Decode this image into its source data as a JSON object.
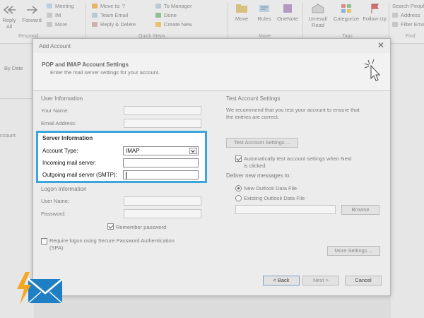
{
  "ribbon": {
    "reply_label": "Reply",
    "reply_all_label": "All",
    "forward_label": "Forward",
    "meeting_label": "Meeting",
    "im_label": "IM",
    "more_label": "More",
    "respond_group": "Respond",
    "move_to_label": "Move to: ?",
    "team_email_label": "Team Email",
    "reply_delete_label": "Reply & Delete",
    "to_manager_label": "To Manager",
    "done_label": "Done",
    "create_new_label": "Create New",
    "quick_steps_group": "Quick Steps",
    "move_label": "Move",
    "rules_label": "Rules",
    "onenote_label": "OneNote",
    "move_group": "Move",
    "unread_read_label": "Unread/ Read",
    "categorize_label": "Categorize",
    "follow_up_label": "Follow Up",
    "tags_group": "Tags",
    "search_people_label": "Search People",
    "address_book_label": "Address",
    "filter_email_label": "Filter Email",
    "find_group": "Find"
  },
  "left_pane": {
    "by_date_label": "By Date",
    "account_label": "ccount"
  },
  "dialog": {
    "title": "Add Account",
    "header_title": "POP and IMAP Account Settings",
    "header_subtitle": "Enter the mail server settings for your account.",
    "user_info": {
      "heading": "User Information",
      "your_name_label": "Your Name:",
      "your_name_value": "",
      "email_label": "Email Address:",
      "email_value": ""
    },
    "server_info": {
      "heading": "Server Information",
      "account_type_label": "Account Type:",
      "account_type_value": "IMAP",
      "incoming_label": "Incoming mail server:",
      "incoming_value": "",
      "outgoing_label": "Outgoing mail server (SMTP):",
      "outgoing_value": ""
    },
    "logon_info": {
      "heading": "Logon Information",
      "user_name_label": "User Name:",
      "user_name_value": "",
      "password_label": "Password:",
      "password_value": "",
      "remember_password_label": "Remember password",
      "remember_password_checked": true,
      "spa_label_line1": "Require logon using Secure Password Authentication",
      "spa_label_line2": "(SPA)",
      "spa_checked": false
    },
    "test_settings": {
      "heading": "Test Account Settings",
      "description_line1": "We recommend that you test your account to ensure that",
      "description_line2": "the entries are correct.",
      "test_button_label": "Test Account Settings ...",
      "auto_test_line1": "Automatically test account settings when Next",
      "auto_test_line2": "is clicked",
      "auto_test_checked": true
    },
    "deliver": {
      "heading": "Deliver new messages to:",
      "new_file_label": "New Outlook Data File",
      "new_file_selected": true,
      "existing_file_label": "Existing Outlook Data File",
      "existing_file_selected": false,
      "browse_label": "Browse"
    },
    "more_settings_label": "More Settings ...",
    "back_label": "< Back",
    "next_label": "Next >",
    "cancel_label": "Cancel"
  },
  "colors": {
    "highlight_border": "#3aa6db",
    "logo_blue": "#1f7fc4",
    "logo_bolt": "#f5a623"
  }
}
